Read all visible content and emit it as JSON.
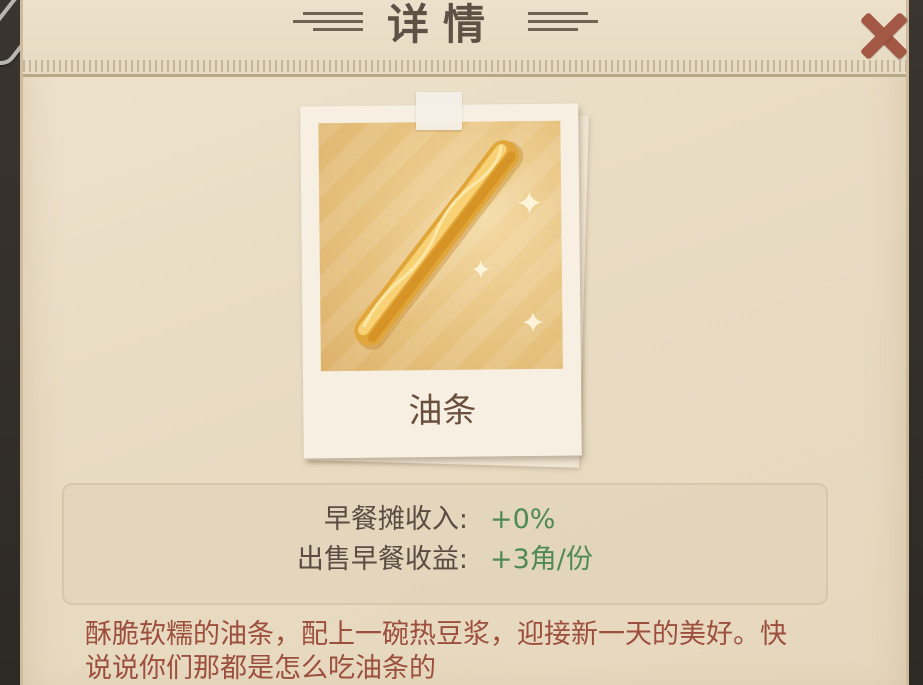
{
  "header": {
    "title": "详情",
    "close_icon": "close-x-icon"
  },
  "item": {
    "name": "油条",
    "image_icon": "youtiao-fried-dough-stick"
  },
  "stats": [
    {
      "label": "早餐摊收入:",
      "value": "+0%"
    },
    {
      "label": "出售早餐收益:",
      "value": "+3角/份"
    }
  ],
  "description": "酥脆软糯的油条，配上一碗热豆浆，迎接新一天的美好。快说说你们那都是怎么吃油条的",
  "colors": {
    "panel": "#e9dcc4",
    "title": "#5e5246",
    "close": "#a35846",
    "stat_value": "#4f8a55",
    "description": "#9b4f3c"
  }
}
